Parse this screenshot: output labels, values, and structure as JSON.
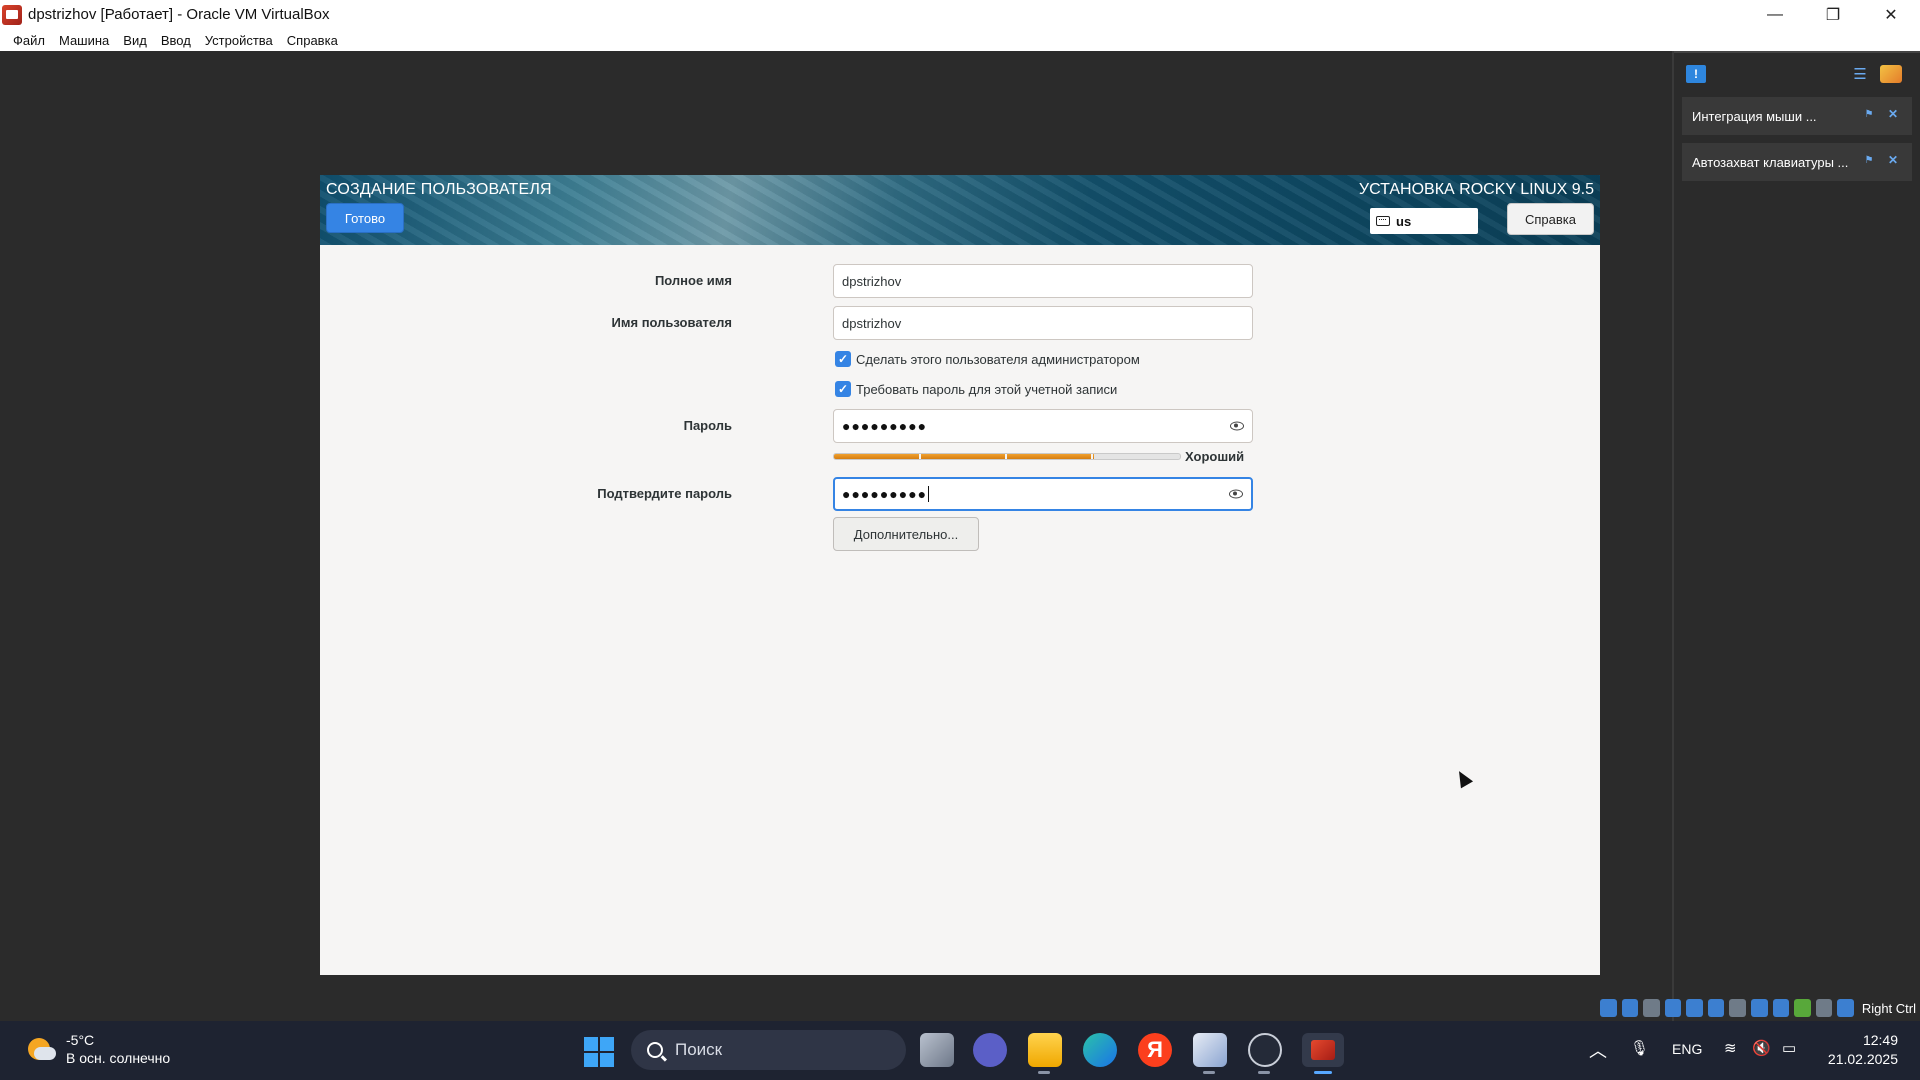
{
  "window": {
    "title": "dpstrizhov [Работает] - Oracle VM VirtualBox",
    "minimize": "—",
    "restore": "❐",
    "close": "✕"
  },
  "menu": [
    "Файл",
    "Машина",
    "Вид",
    "Ввод",
    "Устройства",
    "Справка"
  ],
  "installer": {
    "spoke_title": "СОЗДАНИЕ ПОЛЬЗОВАТЕЛЯ",
    "done_label": "Готово",
    "product_title": "УСТАНОВКА ROCKY LINUX 9.5",
    "keyboard_layout": "us",
    "help_label": "Справка",
    "form": {
      "fullname_label": "Полное имя",
      "fullname_value": "dpstrizhov",
      "username_label": "Имя пользователя",
      "username_value": "dpstrizhov",
      "admin_checkbox_label": "Сделать этого пользователя администратором",
      "admin_checked": true,
      "require_password_label": "Требовать пароль для этой учетной записи",
      "require_password_checked": true,
      "password_label": "Пароль",
      "password_value": "●●●●●●●●●",
      "strength_label": "Хороший",
      "strength_fraction": 0.75,
      "confirm_label": "Подтвердите пароль",
      "confirm_value": "●●●●●●●●●",
      "advanced_label": "Дополнительно..."
    }
  },
  "notifications": {
    "items": [
      {
        "text": "Интеграция мыши ..."
      },
      {
        "text": "Автозахват клавиатуры ..."
      }
    ]
  },
  "statusbar": {
    "host_key": "Right Ctrl"
  },
  "taskbar": {
    "temperature": "-5°C",
    "weather_desc": "В осн. солнечно",
    "search_placeholder": "Поиск",
    "language": "ENG",
    "time": "12:49",
    "date": "21.02.2025"
  },
  "colors": {
    "accent": "#3584e4",
    "strength": "#e08a1e",
    "taskbar": "#1e2331"
  }
}
